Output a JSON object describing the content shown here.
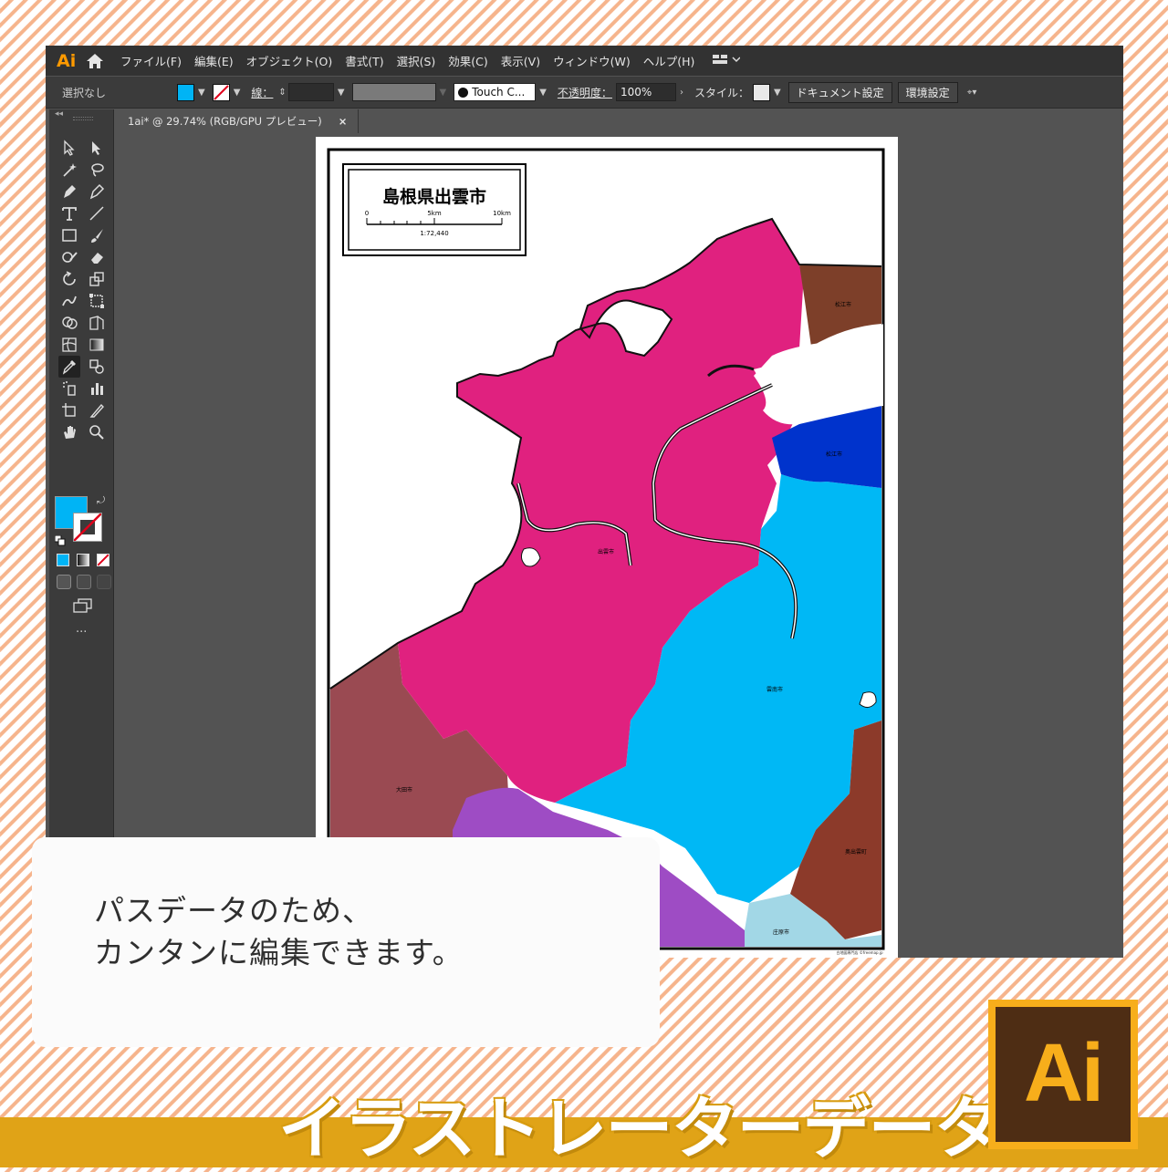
{
  "app": {
    "logo": "Ai",
    "menus": [
      "ファイル(F)",
      "編集(E)",
      "オブジェクト(O)",
      "書式(T)",
      "選択(S)",
      "効果(C)",
      "表示(V)",
      "ウィンドウ(W)",
      "ヘルプ(H)"
    ],
    "control_bar": {
      "selection": "選択なし",
      "stroke_label": "線：",
      "brush": "Touch C...",
      "opacity_label": "不透明度：",
      "opacity_value": "100%",
      "style_label": "スタイル：",
      "doc_settings_button": "ドキュメント設定",
      "prefs_button": "環境設定",
      "fill_color": "#00b4f5"
    },
    "document_tab": {
      "title": "1ai* @ 29.74% (RGB/GPU プレビュー)",
      "close": "×"
    },
    "toolbar": {
      "collapse": "◂◂",
      "more": "..."
    }
  },
  "map": {
    "title": "島根県出雲市",
    "scale_ticks": [
      "0",
      "5km",
      "10km"
    ],
    "scale_ratio": "1:72,440",
    "labels": {
      "matsue_north": "松江市",
      "matsue_east": "松江市",
      "izumo": "出雲市",
      "unnan": "雲南市",
      "oda": "大田市",
      "okuizumo": "奥出雲町",
      "shobara": "庄原市"
    },
    "credit": "白地図専門店 ©freemap.jp",
    "colors": {
      "izumo": "#e0217f",
      "unnan": "#00b8f5",
      "oda": "#9a4a52",
      "matsue_north": "#7d3f29",
      "matsue_east": "#0033cc",
      "purple": "#9e4cc4",
      "okuizumo": "#8c3a2a",
      "shobara": "#a2d7e6"
    }
  },
  "overlay": {
    "line1": "パスデータのため、",
    "line2": "カンタンに編集できます。",
    "banner": "イラストレーターデータ",
    "badge": "Ai"
  }
}
